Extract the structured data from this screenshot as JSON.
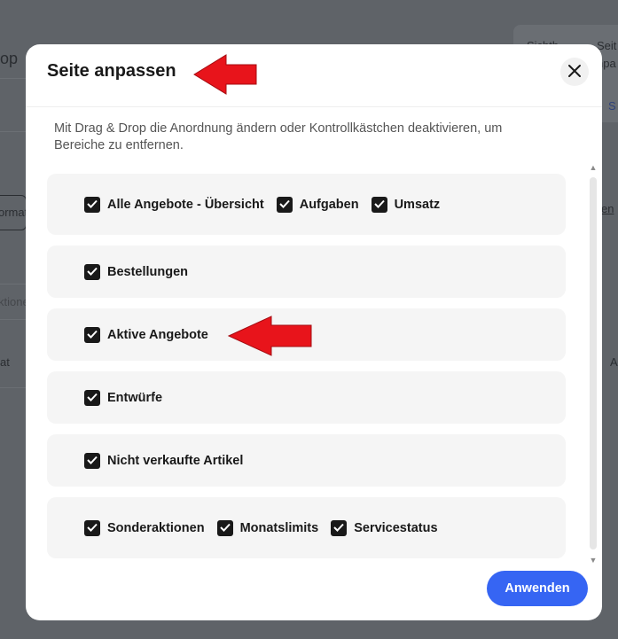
{
  "background": {
    "fragment_top_left": "op",
    "fragment_card_line1": "Sichtb",
    "fragment_card_line2": "Seit",
    "fragment_card_line3": "npa",
    "fragment_left_mid": "ormat",
    "fragment_left_mid2": "ktione",
    "fragment_left_low": "at",
    "fragment_right_mid": "en",
    "fragment_right_low": "A",
    "fragment_right_s": "S"
  },
  "modal": {
    "title": "Seite anpassen",
    "description": "Mit Drag & Drop die Anordnung ändern oder Kontrollkästchen deaktivieren, um Bereiche zu entfernen.",
    "sections": [
      {
        "items": [
          {
            "label": "Alle Angebote - Übersicht",
            "checked": true
          },
          {
            "label": "Aufgaben",
            "checked": true
          },
          {
            "label": "Umsatz",
            "checked": true
          }
        ]
      },
      {
        "items": [
          {
            "label": "Bestellungen",
            "checked": true
          }
        ]
      },
      {
        "items": [
          {
            "label": "Aktive Angebote",
            "checked": true
          }
        ]
      },
      {
        "items": [
          {
            "label": "Entwürfe",
            "checked": true
          }
        ]
      },
      {
        "items": [
          {
            "label": "Nicht verkaufte Artikel",
            "checked": true
          }
        ]
      },
      {
        "items": [
          {
            "label": "Sonderaktionen",
            "checked": true
          },
          {
            "label": "Monatslimits",
            "checked": true
          },
          {
            "label": "Servicestatus",
            "checked": true
          }
        ]
      }
    ],
    "apply_label": "Anwenden"
  },
  "icons": {
    "close": "close-icon",
    "checkmark": "check-icon",
    "scroll_up": "chevron-up-icon",
    "scroll_down": "chevron-down-icon",
    "annotation_arrow": "red-arrow-icon"
  },
  "colors": {
    "overlay": "#5f6368",
    "primary_button": "#3665f3",
    "checkbox": "#191919",
    "section_bg": "#f5f5f5",
    "annotation_arrow": "#e8141b"
  }
}
